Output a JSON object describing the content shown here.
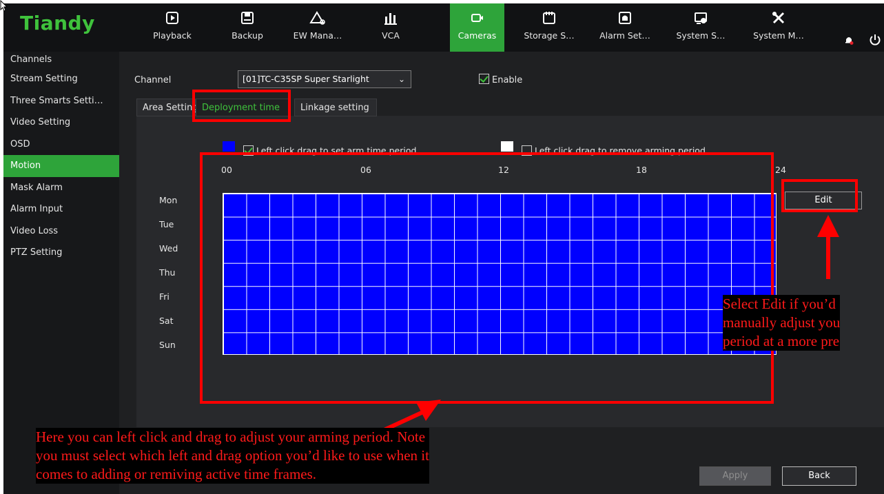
{
  "app": {
    "logo": "Tiandy"
  },
  "nav": [
    {
      "id": "playback",
      "label": "Playback",
      "icon": "playback-icon"
    },
    {
      "id": "backup",
      "label": "Backup",
      "icon": "save-icon"
    },
    {
      "id": "ew-manage",
      "label": "EW Mana…",
      "icon": "warning-icon"
    },
    {
      "id": "vca",
      "label": "VCA",
      "icon": "analytics-icon"
    },
    {
      "id": "cameras",
      "label": "Cameras",
      "icon": "camera-icon",
      "active": true
    },
    {
      "id": "storage",
      "label": "Storage S…",
      "icon": "storage-icon"
    },
    {
      "id": "alarm",
      "label": "Alarm Set…",
      "icon": "alarm-icon"
    },
    {
      "id": "system-settings",
      "label": "System S…",
      "icon": "system-settings-icon"
    },
    {
      "id": "system-maintenance",
      "label": "System M…",
      "icon": "tools-icon"
    }
  ],
  "sidebar": {
    "items": [
      {
        "label": "Channels",
        "head": true
      },
      {
        "label": "Stream Setting"
      },
      {
        "label": "Three Smarts Setti…"
      },
      {
        "label": "Video Setting"
      },
      {
        "label": "OSD"
      },
      {
        "label": "Motion",
        "active": true
      },
      {
        "label": "Mask Alarm"
      },
      {
        "label": "Alarm Input"
      },
      {
        "label": "Video Loss"
      },
      {
        "label": "PTZ Setting"
      }
    ]
  },
  "form": {
    "channel_label": "Channel",
    "channel_value": "[01]TC-C35SP Super Starlight",
    "enable_label": "Enable",
    "enable_checked": true
  },
  "tabs": [
    {
      "label": "Area Setting"
    },
    {
      "label": "Deployment time",
      "active": true
    },
    {
      "label": "Linkage setting"
    }
  ],
  "legend": {
    "arm_text": "Left click drag to set arm time period",
    "arm_color": "#0000ff",
    "arm_checked": true,
    "remove_text": "Left click drag to remove arming period",
    "remove_color": "#ffffff",
    "remove_checked": false
  },
  "schedule": {
    "hours": [
      "00",
      "06",
      "12",
      "18",
      "24"
    ],
    "days": [
      "Mon",
      "Tue",
      "Wed",
      "Thu",
      "Fri",
      "Sat",
      "Sun"
    ],
    "armed_color": "#0000ff"
  },
  "buttons": {
    "edit": "Edit",
    "apply": "Apply",
    "back": "Back"
  },
  "annotations": {
    "edit_note": [
      "Select Edit if you’d",
      "manually adjust you",
      "period at a more pre"
    ],
    "drag_note": [
      "Here you can left click and drag to adjust your arming period.  Note",
      "you must select which left and drag option you’d like to use when it",
      "comes to adding or remiving active time frames."
    ],
    "highlight_color": "#ff0000"
  }
}
